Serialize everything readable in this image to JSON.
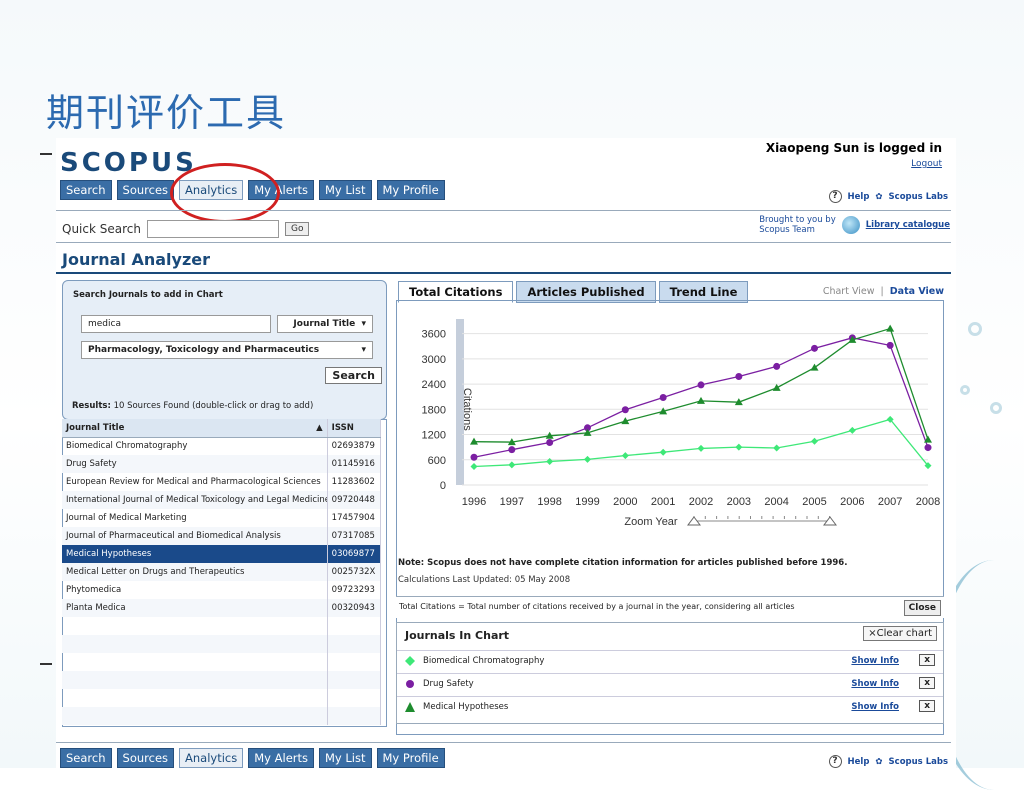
{
  "slide": {
    "title": "期刊评价工具"
  },
  "header": {
    "logo": "SCOPUS",
    "user": "Xiaopeng Sun is logged in",
    "logout": "Logout",
    "help": "Help",
    "labs": "Scopus Labs",
    "nav": [
      "Search",
      "Sources",
      "Analytics",
      "My Alerts",
      "My List",
      "My Profile"
    ],
    "active_nav": "Analytics"
  },
  "quick_search": {
    "label": "Quick Search",
    "value": "",
    "go": "Go"
  },
  "brought": {
    "line1": "Brought to you by",
    "line2": "Scopus Team",
    "link": "Library catalogue"
  },
  "page_title": "Journal Analyzer",
  "search_panel": {
    "title": "Search Journals to add in Chart",
    "query": "medica",
    "field_select": "Journal Title",
    "subject_select": "Pharmacology, Toxicology and Pharmaceutics",
    "search_button": "Search",
    "results_label": "Results:",
    "results_text": "10 Sources Found (double-click or drag to add)"
  },
  "journal_table": {
    "columns": [
      "Journal Title",
      "ISSN"
    ],
    "sort_indicator": "▲",
    "rows": [
      {
        "title": "Biomedical Chromatography",
        "issn": "02693879"
      },
      {
        "title": "Drug Safety",
        "issn": "01145916"
      },
      {
        "title": "European Review for Medical and Pharmacological Sciences",
        "issn": "11283602"
      },
      {
        "title": "International Journal of Medical Toxicology and Legal Medicine",
        "issn": "09720448"
      },
      {
        "title": "Journal of Medical Marketing",
        "issn": "17457904"
      },
      {
        "title": "Journal of Pharmaceutical and Biomedical Analysis",
        "issn": "07317085"
      },
      {
        "title": "Medical Hypotheses",
        "issn": "03069877"
      },
      {
        "title": "Medical Letter on Drugs and Therapeutics",
        "issn": "0025732X"
      },
      {
        "title": "Phytomedica",
        "issn": "09723293"
      },
      {
        "title": "Planta Medica",
        "issn": "00320943"
      }
    ],
    "selected": 6
  },
  "tabs": [
    "Total Citations",
    "Articles Published",
    "Trend Line"
  ],
  "active_tab": "Total Citations",
  "views": {
    "chart": "Chart View",
    "data": "Data View",
    "sep": "|"
  },
  "chart_data": {
    "type": "line",
    "x": [
      1996,
      1997,
      1998,
      1999,
      2000,
      2001,
      2002,
      2003,
      2004,
      2005,
      2006,
      2007,
      2008
    ],
    "xlabel": "Zoom Year",
    "ylabel": "Citations",
    "yticks": [
      0,
      600,
      1200,
      1800,
      2400,
      3000,
      3600
    ],
    "ylim": [
      0,
      3900
    ],
    "grid": true,
    "series": [
      {
        "name": "Biomedical Chromatography",
        "color": "#3ee878",
        "marker": "diamond",
        "values": [
          440,
          480,
          560,
          610,
          700,
          780,
          870,
          900,
          880,
          1040,
          1300,
          1560,
          460
        ]
      },
      {
        "name": "Drug Safety",
        "color": "#7b1fa2",
        "marker": "circle",
        "values": [
          660,
          840,
          1010,
          1360,
          1790,
          2080,
          2380,
          2580,
          2820,
          3250,
          3500,
          3320,
          890
        ]
      },
      {
        "name": "Medical Hypotheses",
        "color": "#1e8c2e",
        "marker": "triangle",
        "values": [
          1030,
          1020,
          1170,
          1240,
          1520,
          1750,
          2000,
          1970,
          2310,
          2790,
          3450,
          3720,
          1080
        ]
      }
    ]
  },
  "chart_note": {
    "bold": "Note: Scopus does not have complete citation information for articles published before 1996.",
    "calc": "Calculations Last Updated: 05 May 2008"
  },
  "description": "Total Citations = Total number of citations received by a journal in the year, considering all articles",
  "close_button": "Close",
  "journals_in_chart": {
    "title": "Journals In Chart",
    "clear": "×Clear chart",
    "show_info": "Show Info",
    "remove": "x",
    "items": [
      "Biomedical Chromatography",
      "Drug Safety",
      "Medical Hypotheses"
    ]
  }
}
